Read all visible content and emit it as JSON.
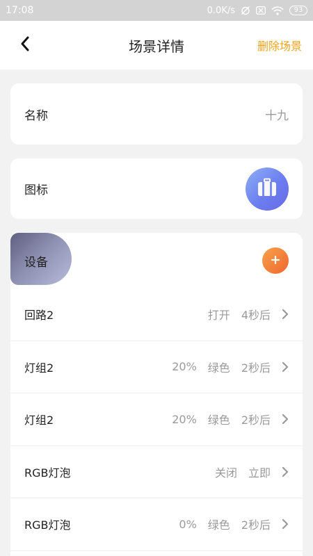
{
  "status_bar": {
    "time": "17:08",
    "network_speed": "0.0K/s",
    "battery": "93",
    "icons": [
      "alarm-off-icon",
      "sim-off-icon",
      "wifi-icon",
      "battery-icon"
    ]
  },
  "header": {
    "title": "场景详情",
    "delete_label": "删除场景",
    "accent_color": "#f2a31d"
  },
  "name_section": {
    "label": "名称",
    "value": "十九"
  },
  "icon_section": {
    "label": "图标",
    "icon": "suitcase-icon"
  },
  "devices_section": {
    "label": "设备",
    "add_icon": "plus-icon",
    "items": [
      {
        "name": "回路2",
        "level": "",
        "action": "打开",
        "delay": "4秒后"
      },
      {
        "name": "灯组2",
        "level": "20%",
        "action": "绿色",
        "delay": "2秒后"
      },
      {
        "name": "灯组2",
        "level": "20%",
        "action": "绿色",
        "delay": "2秒后"
      },
      {
        "name": "RGB灯泡",
        "level": "",
        "action": "关闭",
        "delay": "立即"
      },
      {
        "name": "RGB灯泡",
        "level": "0%",
        "action": "绿色",
        "delay": "2秒后"
      }
    ]
  }
}
